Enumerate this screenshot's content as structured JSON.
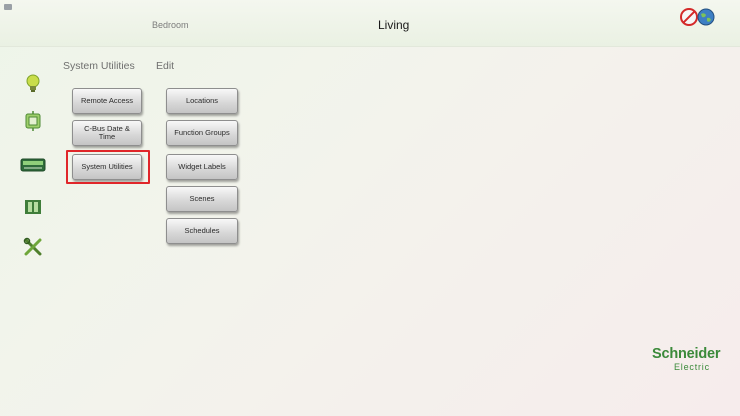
{
  "header": {
    "room_previous": "Bedroom",
    "room_current": "Living",
    "status_icons": [
      "no-entry-icon",
      "globe-icon"
    ]
  },
  "sidebar": {
    "items": [
      {
        "icon": "lightbulb-icon"
      },
      {
        "icon": "thermostat-icon"
      },
      {
        "icon": "air-conditioner-icon"
      },
      {
        "icon": "blinds-icon"
      },
      {
        "icon": "tools-icon"
      }
    ]
  },
  "breadcrumb": {
    "system_utilities": "System Utilities",
    "edit": "Edit"
  },
  "left_buttons": {
    "remote_access": "Remote Access",
    "cbus_date_line1": "C-Bus Date &",
    "cbus_date_line2": "Time",
    "system_utilities": "System Utilities"
  },
  "edit_buttons": {
    "locations": "Locations",
    "function_groups": "Function Groups",
    "widget_labels": "Widget Labels",
    "scenes": "Scenes",
    "schedules": "Schedules"
  },
  "brand": {
    "name": "Schneider",
    "sub": "Electric",
    "color": "#3b8a3a"
  },
  "colors": {
    "highlight": "#e0262a"
  }
}
